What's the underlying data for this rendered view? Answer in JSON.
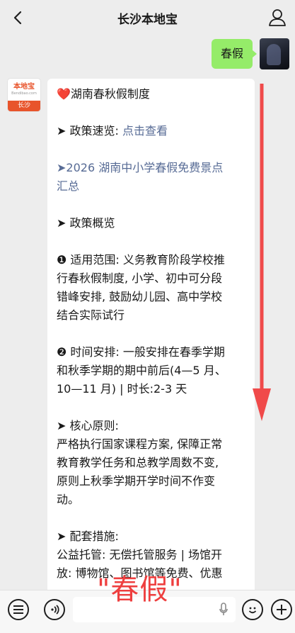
{
  "header": {
    "title": "长沙本地宝"
  },
  "outgoing": {
    "text": "春假"
  },
  "bot_avatar": {
    "logo_text": "本地宝",
    "logo_domain": "Bendibao.com",
    "city_label": "长沙"
  },
  "message": {
    "heart": "❤️",
    "title": "湖南春秋假制度",
    "policy_quick_label": "➤ 政策速览: ",
    "policy_quick_link": "点击查看",
    "scenic_link_l1": "➤2026 湖南中小学春假免费景点",
    "scenic_link_l2": "汇总",
    "overview_title": "➤ 政策概览",
    "scope": [
      "❶ 适用范围: 义务教育阶段学校推",
      "行春秋假制度, 小学、初中可分段",
      "错峰安排, 鼓励幼儿园、高中学校",
      "结合实际试行"
    ],
    "timing": [
      "❷ 时间安排: 一般安排在春季学期",
      "和秋季学期的期中前后(4—5 月、",
      "10—11 月) | 时长:2-3 天"
    ],
    "principle_title": "➤ 核心原则:",
    "principle": [
      "严格执行国家课程方案, 保障正常",
      "教育教学任务和总教学周数不变,",
      "原则上秋季学期开学时间不作变",
      "动。"
    ],
    "measures_title": "➤ 配套措施:",
    "measures": [
      "公益托管: 无偿托管服务 | 场馆开",
      "放: 博物馆、图书馆等免费、优惠"
    ]
  },
  "annotation": {
    "text": "\"春假\"",
    "color": "#ee3f3f"
  },
  "icons": [
    "chevron-left-icon",
    "user-icon",
    "menu-icon",
    "voice-icon",
    "mic-icon",
    "emoji-icon",
    "plus-icon"
  ]
}
